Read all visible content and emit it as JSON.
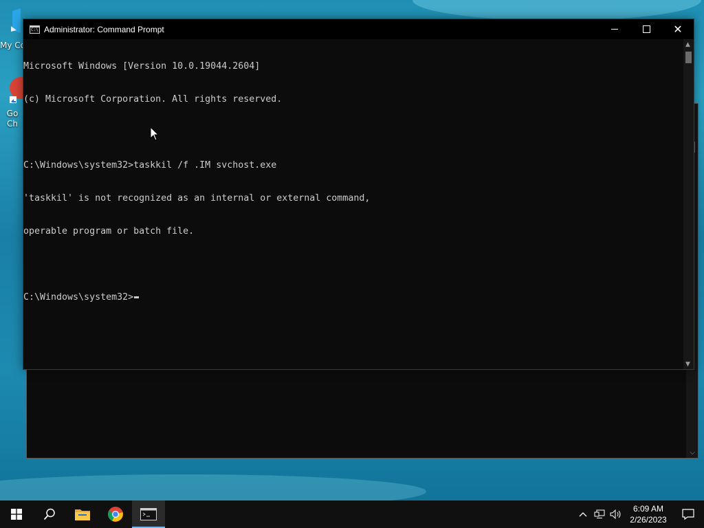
{
  "desktop": {
    "icons": [
      {
        "label": "My Co"
      },
      {
        "label_line1": "Go",
        "label_line2": "Ch"
      }
    ]
  },
  "window": {
    "title": "Administrator: Command Prompt",
    "controls": {
      "minimize": "minimize",
      "maximize": "maximize",
      "close": "close"
    }
  },
  "console": {
    "lines": [
      "Microsoft Windows [Version 10.0.19044.2604]",
      "(c) Microsoft Corporation. All rights reserved.",
      "",
      "C:\\Windows\\system32>taskkil /f .IM svchost.exe",
      "'taskkil' is not recognized as an internal or external command,",
      "operable program or batch file.",
      "",
      "C:\\Windows\\system32>"
    ]
  },
  "taskbar": {
    "items": [
      {
        "name": "start",
        "icon": "windows-logo-icon"
      },
      {
        "name": "search",
        "icon": "search-icon"
      },
      {
        "name": "file-explorer",
        "icon": "folder-icon"
      },
      {
        "name": "chrome",
        "icon": "chrome-icon"
      },
      {
        "name": "command-prompt",
        "icon": "cmd-icon",
        "active": true
      }
    ],
    "tray": {
      "time": "6:09 AM",
      "date": "2/26/2023"
    }
  },
  "colors": {
    "console_bg": "#0c0c0c",
    "console_text": "#cccccc",
    "taskbar_bg": "#101010",
    "accent": "#76b9ed"
  }
}
